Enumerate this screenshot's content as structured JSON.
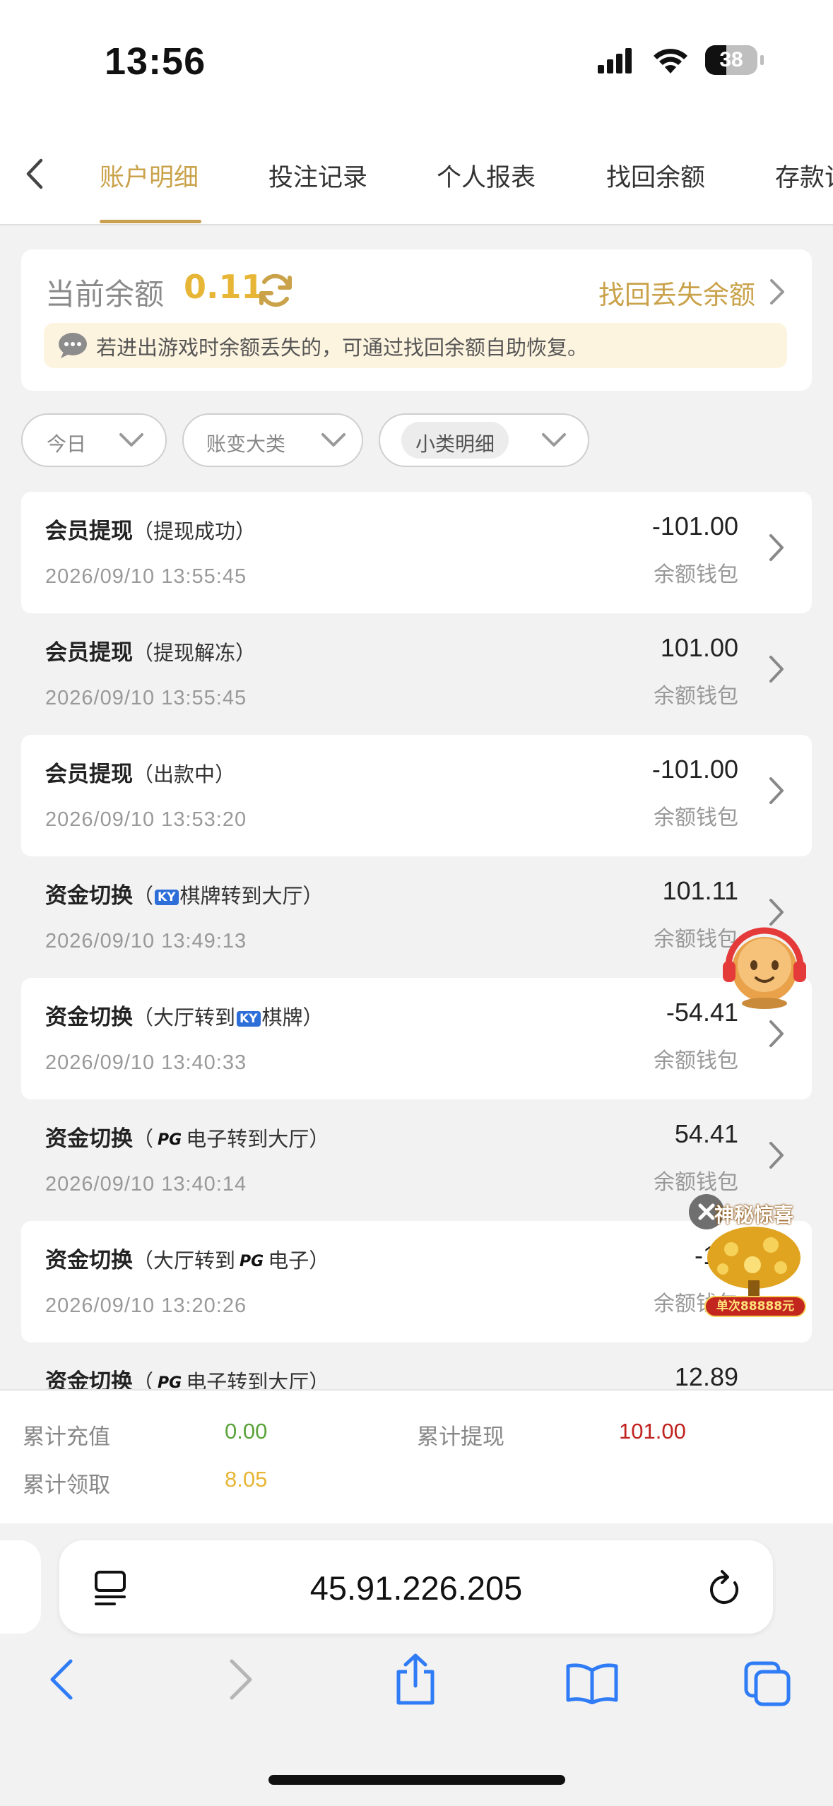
{
  "status_bar": {
    "time": "13:56",
    "battery": "38"
  },
  "tabs": [
    {
      "label": "账户明细",
      "active": true
    },
    {
      "label": "投注记录",
      "active": false
    },
    {
      "label": "个人报表",
      "active": false
    },
    {
      "label": "找回余额",
      "active": false
    },
    {
      "label": "存款记",
      "active": false
    }
  ],
  "balance": {
    "label": "当前余额",
    "value": "0.11",
    "recover_link": "找回丢失余额",
    "notice": "若进出游戏时余额丢失的，可通过找回余额自助恢复。"
  },
  "filters": [
    {
      "label": "今日"
    },
    {
      "label": "账变大类"
    },
    {
      "label": "小类明细"
    }
  ],
  "records": [
    {
      "title": "会员提现",
      "detail": "（提现成功）",
      "time": "2026/09/10 13:55:45",
      "amount": "-101.00",
      "wallet": "余额钱包"
    },
    {
      "title": "会员提现",
      "detail": "（提现解冻）",
      "time": "2026/09/10 13:55:45",
      "amount": "101.00",
      "wallet": "余额钱包"
    },
    {
      "title": "会员提现",
      "detail": "（出款中）",
      "time": "2026/09/10 13:53:20",
      "amount": "-101.00",
      "wallet": "余额钱包"
    },
    {
      "title": "资金切换",
      "detail_pre": "（",
      "chip": "KY",
      "detail": "棋牌转到大厅）",
      "time": "2026/09/10 13:49:13",
      "amount": "101.11",
      "wallet": "余额钱包"
    },
    {
      "title": "资金切换",
      "detail_pre": "（大厅转到",
      "chip": "KY",
      "detail": "棋牌）",
      "time": "2026/09/10 13:40:33",
      "amount": "-54.41",
      "wallet": "余额钱包"
    },
    {
      "title": "资金切换",
      "detail_pre": "（",
      "chip": "PG",
      "detail": "电子转到大厅）",
      "time": "2026/09/10 13:40:14",
      "amount": "54.41",
      "wallet": "余额钱包"
    },
    {
      "title": "资金切换",
      "detail_pre": "（大厅转到",
      "chip": "PG",
      "detail": "电子）",
      "time": "2026/09/10 13:20:26",
      "amount": "-12.",
      "wallet": "余额钱包"
    },
    {
      "title": "资金切换",
      "detail_pre": "（",
      "chip": "PG",
      "detail": "电子转到大厅）",
      "amount": "12.89"
    }
  ],
  "promo": {
    "title": "神秘惊喜",
    "subtitle": "单次88888元"
  },
  "summary": {
    "recharge_label": "累计充值",
    "recharge_value": "0.00",
    "withdraw_label": "累计提现",
    "withdraw_value": "101.00",
    "claim_label": "累计领取",
    "claim_value": "8.05"
  },
  "browser": {
    "url": "45.91.226.205"
  },
  "colors": {
    "accent": "#c9a24a",
    "green": "#5aa33a",
    "red": "#c0231f",
    "gold": "#e8b636"
  }
}
